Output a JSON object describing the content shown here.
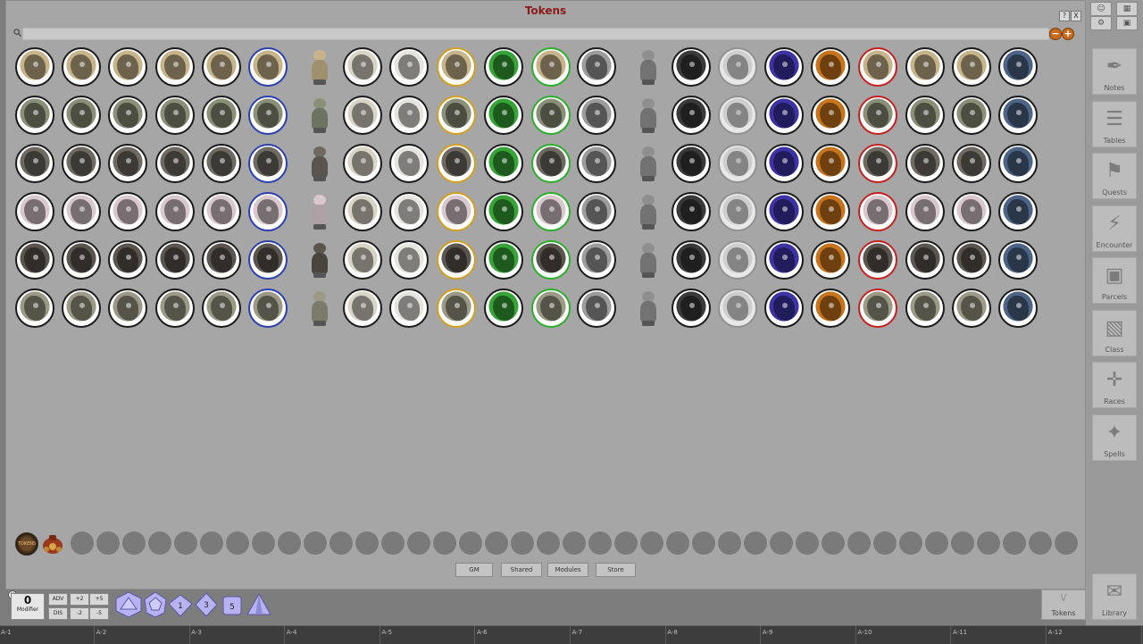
{
  "window": {
    "title": "Tokens",
    "controls": [
      "?",
      "X"
    ],
    "search_placeholder": "",
    "zoom_out_label": "−",
    "zoom_in_label": "+"
  },
  "token_grid": {
    "rows": [
      "helm",
      "lizardfolk",
      "ogre",
      "elf-woman",
      "hooded-rat",
      "dragon-horse"
    ],
    "column_styles": [
      "natural",
      "natural",
      "natural",
      "natural",
      "natural",
      "blue-ring",
      "figure",
      "faded",
      "faded-light",
      "gold-ring",
      "green-tint",
      "green-ring",
      "greyscale",
      "figure-grey",
      "dark",
      "ghost",
      "purple-tint",
      "orange-tint",
      "red-ring",
      "natural",
      "natural",
      "blue-tint"
    ]
  },
  "tray": {
    "library_token_label": "TOKENS",
    "empty_slots": 39
  },
  "tabs": [
    "GM",
    "Shared",
    "Modules",
    "Store"
  ],
  "sidebar": {
    "items": [
      {
        "label": "Notes",
        "icon": "quill-icon"
      },
      {
        "label": "Tables",
        "icon": "list-icon"
      },
      {
        "label": "Quests",
        "icon": "flag-icon"
      },
      {
        "label": "Encounter",
        "icon": "lightning-icon"
      },
      {
        "label": "Parcels",
        "icon": "box-icon"
      },
      {
        "label": "Class",
        "icon": "portrait-icon"
      },
      {
        "label": "Races",
        "icon": "dna-icon"
      },
      {
        "label": "Spells",
        "icon": "wand-icon"
      }
    ],
    "tokens_label": "Tokens",
    "library_label": "Library"
  },
  "modifier": {
    "value": "0",
    "label": "Modifier",
    "buttons": [
      "ADV",
      "+2",
      "+5",
      "DIS",
      "-2",
      "-5"
    ]
  },
  "dice": [
    "d20",
    "d12",
    "d10",
    "3",
    "5",
    ""
  ],
  "hotkeys": [
    "A-1",
    "A-2",
    "A-3",
    "A-4",
    "A-5",
    "A-6",
    "A-7",
    "A-8",
    "A-9",
    "A-10",
    "A-11",
    "A-12"
  ],
  "colors": {
    "title": "#8b1a1a",
    "blue_ring": "#2b3fb0",
    "gold_ring": "#d4a020",
    "green_ring": "#2cae2c",
    "red_ring": "#c42020",
    "zoom_button": "#c96a1c"
  }
}
